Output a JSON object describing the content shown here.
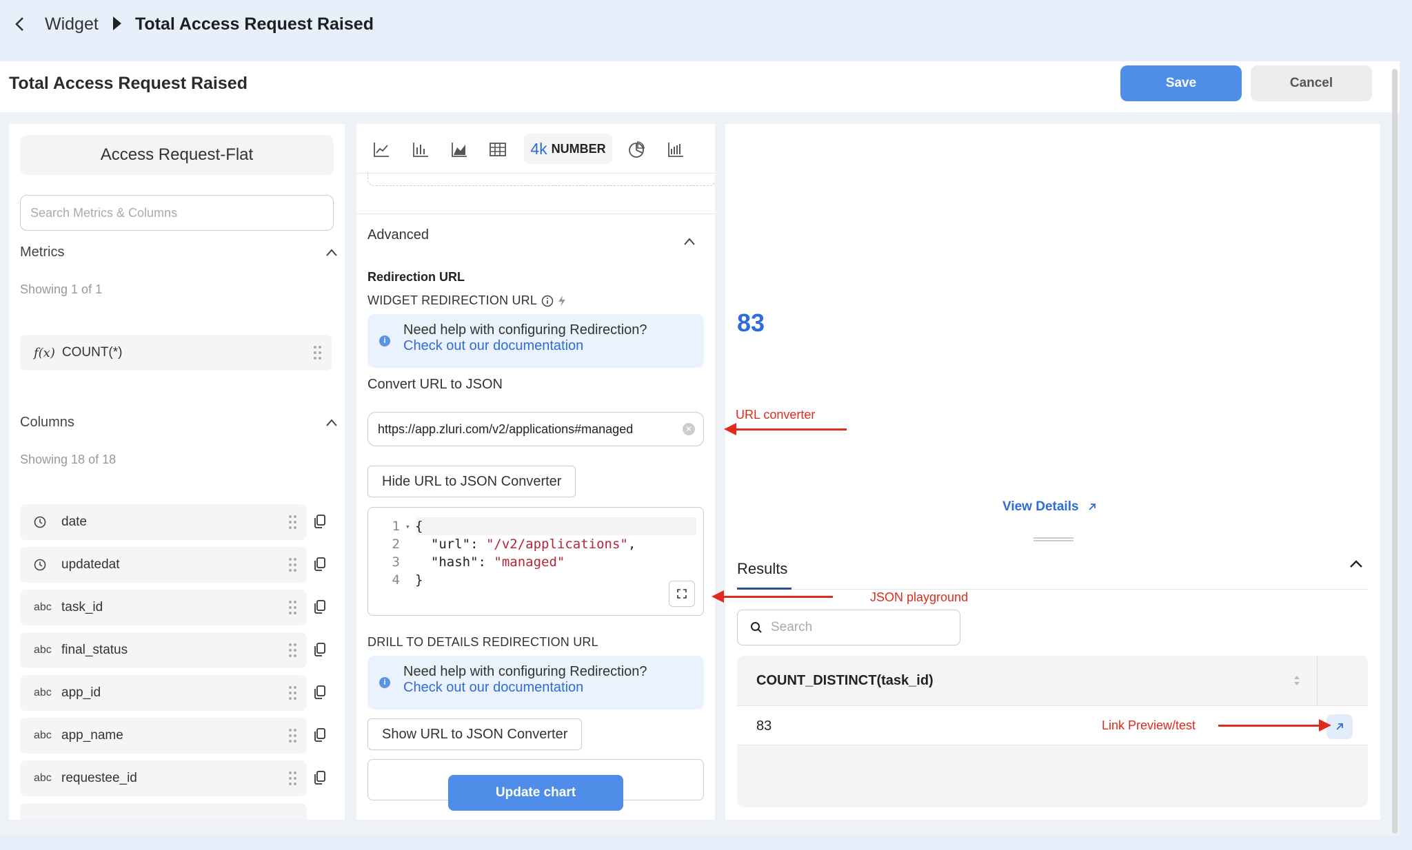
{
  "breadcrumb": {
    "parent": "Widget",
    "current": "Total Access Request Raised"
  },
  "header": {
    "title": "Total Access Request Raised",
    "save_label": "Save",
    "cancel_label": "Cancel"
  },
  "left": {
    "dataset": "Access Request-Flat",
    "search_placeholder": "Search Metrics & Columns",
    "metrics_title": "Metrics",
    "metrics_showing": "Showing 1 of 1",
    "metric_fx": "f(x)",
    "metric_label": "COUNT(*)",
    "columns_title": "Columns",
    "columns_showing": "Showing 18 of 18",
    "columns": [
      {
        "type": "clock",
        "name": "date"
      },
      {
        "type": "clock",
        "name": "updatedat"
      },
      {
        "type": "abc",
        "name": "task_id"
      },
      {
        "type": "abc",
        "name": "final_status"
      },
      {
        "type": "abc",
        "name": "app_id"
      },
      {
        "type": "abc",
        "name": "app_name"
      },
      {
        "type": "abc",
        "name": "requestee_id"
      }
    ]
  },
  "middle": {
    "number_tab_k": "4k",
    "number_tab_label": "NUMBER",
    "advanced_title": "Advanced",
    "redirection_url_label": "Redirection URL",
    "widget_redirection_label": "WIDGET REDIRECTION URL",
    "help_text": "Need help with configuring Redirection?",
    "help_link": "Check out our documentation",
    "convert_label": "Convert URL to JSON",
    "url_value": "https://app.zluri.com/v2/applications#managed",
    "hide_converter_label": "Hide URL to JSON Converter",
    "json_lines": [
      {
        "num": "1",
        "text": "{"
      },
      {
        "num": "2",
        "key": "  \"url\": ",
        "val": "\"/v2/applications\"",
        "tail": ","
      },
      {
        "num": "3",
        "key": "  \"hash\": ",
        "val": "\"managed\"",
        "tail": ""
      },
      {
        "num": "4",
        "text": "}"
      }
    ],
    "drill_label": "DRILL TO DETAILS REDIRECTION URL",
    "help_text_2": "Need help with configuring Redirection?",
    "help_link_2": "Check out our documentation",
    "show_converter_label": "Show URL to JSON Converter",
    "update_chart_label": "Update chart"
  },
  "right": {
    "value": "83",
    "view_details": "View Details",
    "results_title": "Results",
    "search_placeholder": "Search",
    "table_header": "COUNT_DISTINCT(task_id)",
    "table_value": "83"
  },
  "annotations": {
    "url_converter": "URL converter",
    "json_playground": "JSON playground",
    "link_preview": "Link Preview/test"
  },
  "colors": {
    "accent": "#4e8ee8",
    "link": "#2f6bd9",
    "annotation": "#e02a1c"
  }
}
